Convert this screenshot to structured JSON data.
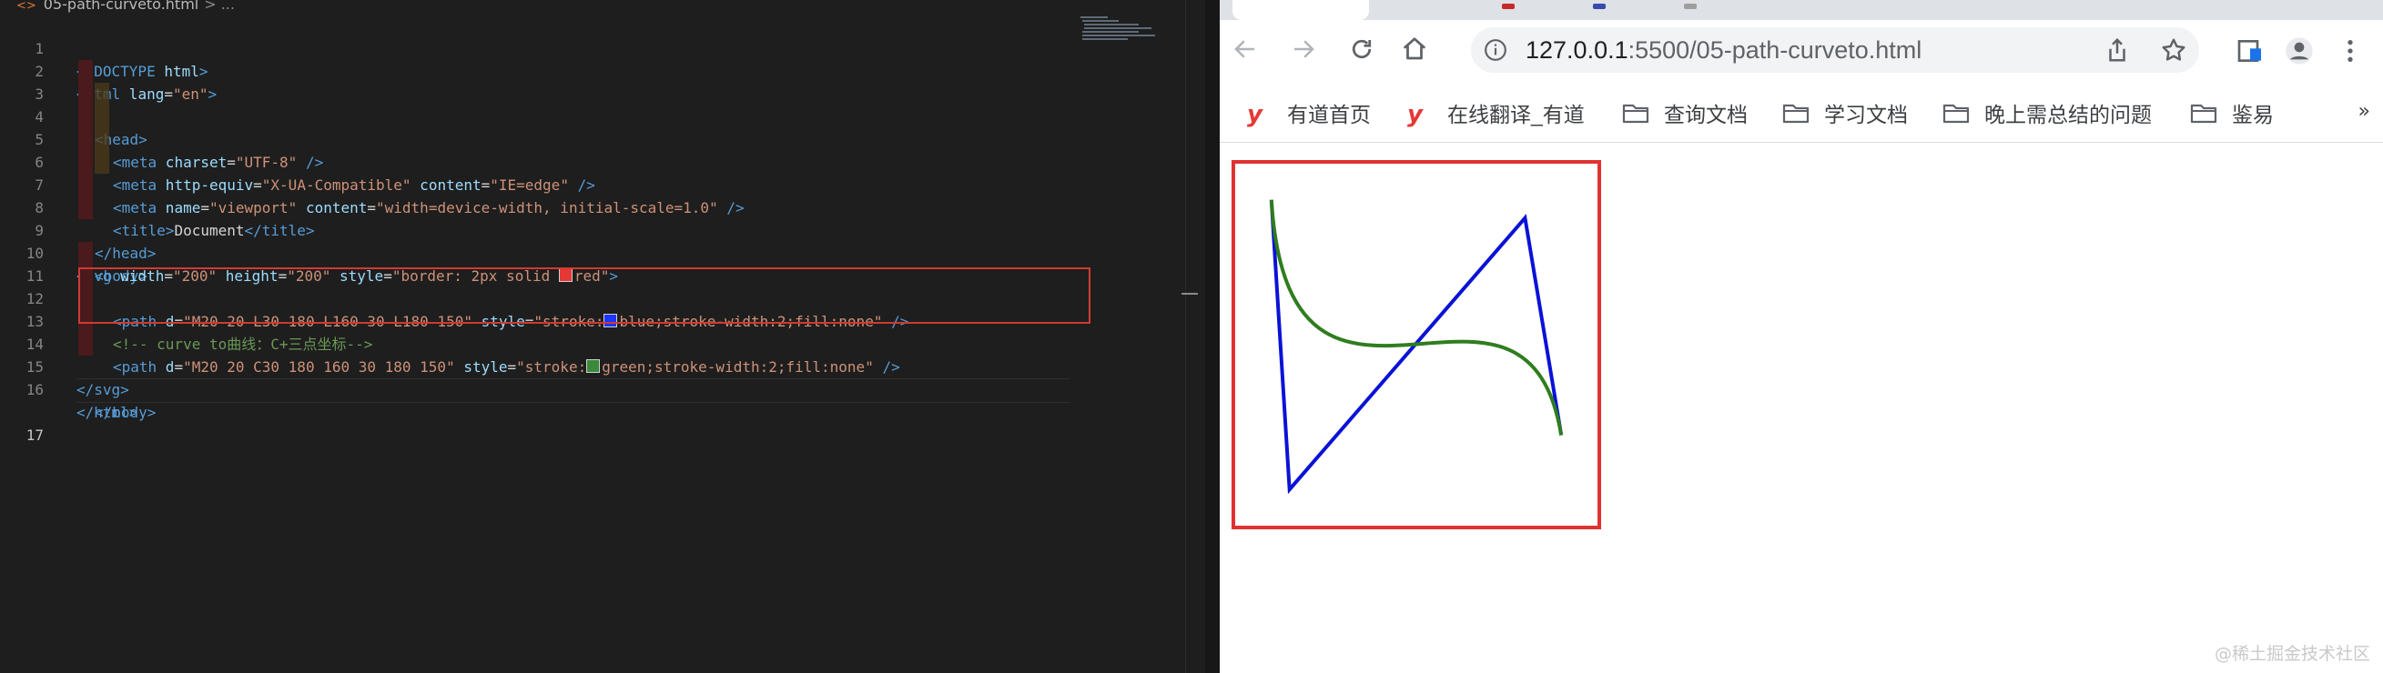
{
  "editor": {
    "breadcrumb": {
      "file": "05-path-curveto.html",
      "trail": "> ..."
    },
    "line_numbers": [
      "1",
      "2",
      "3",
      "4",
      "5",
      "6",
      "7",
      "8",
      "9",
      "10",
      "11",
      "12",
      "13",
      "14",
      "15",
      "16",
      "17"
    ],
    "lines": {
      "l1": {
        "doctype": "<!DOCTYPE",
        "name": " html",
        "close": ">"
      },
      "l2": {
        "open": "<html",
        "attr": " lang",
        "eq": "=",
        "val": "\"en\"",
        "close": ">"
      },
      "l3": {
        "tag": "<head>"
      },
      "l4": {
        "open": "<meta",
        "attr": " charset",
        "eq": "=",
        "val": "\"UTF-8\"",
        "close": " />"
      },
      "l5": {
        "open": "<meta",
        "attr1": " http-equiv",
        "eq1": "=",
        "val1": "\"X-UA-Compatible\"",
        "attr2": " content",
        "eq2": "=",
        "val2": "\"IE=edge\"",
        "close": " />"
      },
      "l6": {
        "open": "<meta",
        "attr1": " name",
        "eq1": "=",
        "val1": "\"viewport\"",
        "attr2": " content",
        "eq2": "=",
        "val2": "\"width=device-width, initial-scale=1.0\"",
        "close": " />"
      },
      "l7": {
        "open": "<title>",
        "text": "Document",
        "close": "</title>"
      },
      "l8": {
        "tag": "</head>"
      },
      "l9": {
        "tag": "<body>"
      },
      "l10": {
        "open": "<svg",
        "attr1": " width",
        "eq1": "=",
        "val1": "\"200\"",
        "attr2": " height",
        "eq2": "=",
        "val2": "\"200\"",
        "attr3": " style",
        "eq3": "=",
        "val3a": "\"border: 2px solid ",
        "val3b": "red\"",
        "close": ">"
      },
      "l11": {
        "open": "<path",
        "attr1": " d",
        "eq1": "=",
        "val1": "\"M20 20 L30 180 L160 30 L180 150\"",
        "attr2": " style",
        "eq2": "=",
        "val2a": "\"stroke:",
        "val2b": "blue;stroke-width:2;fill:none\"",
        "close": " />"
      },
      "l12": {
        "comment": "<!-- curve to曲线：C+三点坐标-->"
      },
      "l13": {
        "open": "<path",
        "attr1": " d",
        "eq1": "=",
        "val1": "\"M20 20 C30 180 160 30 180 150\"",
        "attr2": " style",
        "eq2": "=",
        "val2a": "\"stroke:",
        "val2b": "green;stroke-width:2;fill:none\"",
        "close": " />"
      },
      "l14": {
        "tag": "</svg>"
      },
      "l15": {
        "tag": "</body>"
      },
      "l16": {
        "tag": "</html>"
      }
    },
    "swatch_colors": {
      "red": "#e53935",
      "blue": "#1e34ff",
      "green": "#3b8a3b"
    }
  },
  "browser": {
    "url_host": "127.0.0.1",
    "url_rest": ":5500/05-path-curveto.html",
    "bookmarks": [
      {
        "label": "有道首页",
        "icon": "youdao-icon"
      },
      {
        "label": "在线翻译_有道",
        "icon": "youdao-icon"
      },
      {
        "label": "查询文档",
        "icon": "folder-icon"
      },
      {
        "label": "学习文档",
        "icon": "folder-icon"
      },
      {
        "label": "晚上需总结的问题",
        "icon": "folder-icon"
      },
      {
        "label": "鉴易",
        "icon": "folder-icon"
      }
    ],
    "youdao_glyph": "y",
    "more_glyph": "»",
    "demo": {
      "border_color": "#e03131",
      "polyline_color": "#0a12d6",
      "curve_color": "#2f7d1e"
    }
  },
  "watermark": "@稀土掘金技术社区"
}
